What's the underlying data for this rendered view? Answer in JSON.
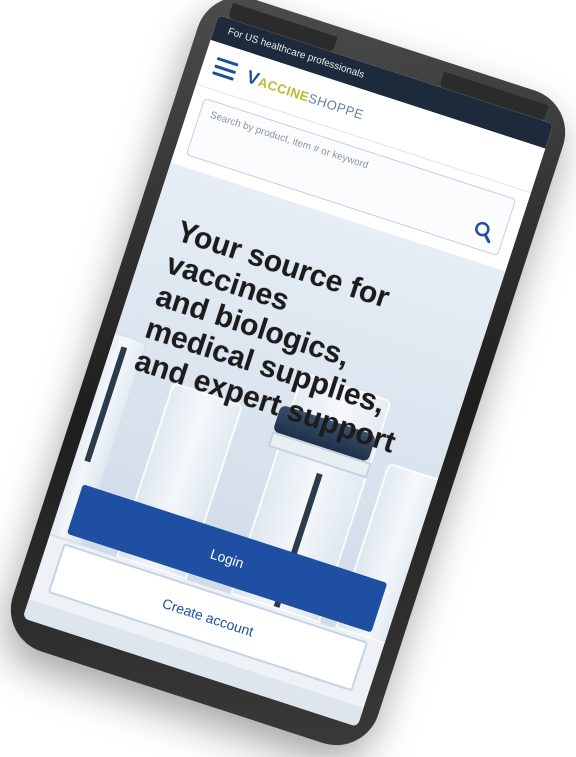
{
  "topbar": {
    "text": "For US healthcare professionals"
  },
  "header": {
    "logo_v": "V",
    "logo_accent": "ACCINE",
    "logo_rest": "SHOPPE"
  },
  "search": {
    "placeholder": "Search by product, item # or keyword",
    "icon": "search-icon"
  },
  "hero": {
    "lines": [
      "Your source for",
      "vaccines",
      "and biologics,",
      "medical supplies,",
      "and expert support"
    ]
  },
  "actions": {
    "login_label": "Login",
    "create_label": "Create account"
  },
  "colors": {
    "brand_blue": "#1f4fa3",
    "logo_green": "#b6be2e",
    "topbar_bg": "#1d2a3b"
  }
}
